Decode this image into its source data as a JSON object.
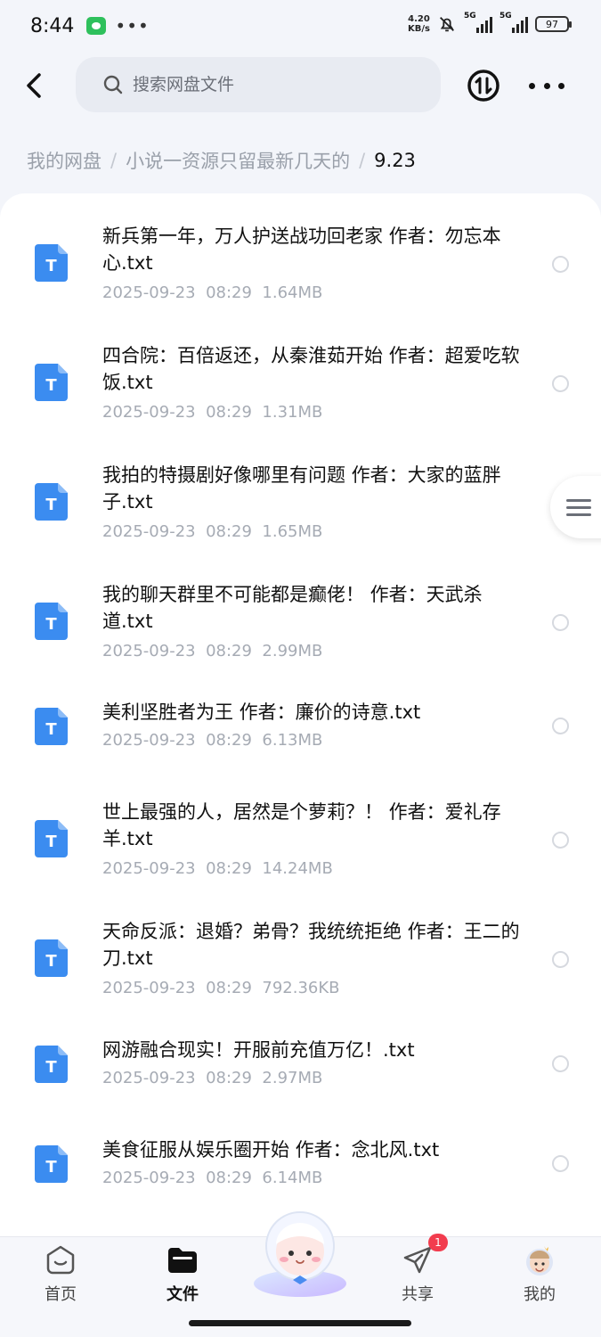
{
  "status_bar": {
    "time": "8:44",
    "net_speed_value": "4.20",
    "net_speed_unit": "KB/s",
    "signal1_label": "5G",
    "signal2_label": "5G",
    "battery": "97"
  },
  "search": {
    "placeholder": "搜索网盘文件"
  },
  "breadcrumb": {
    "items": [
      "我的网盘",
      "小说一资源只留最新几天的"
    ],
    "separator": "/",
    "current": "9.23"
  },
  "files": [
    {
      "name": "新兵第一年，万人护送战功回老家 作者：勿忘本心.txt",
      "date": "2025-09-23",
      "time": "08:29",
      "size": "1.64MB"
    },
    {
      "name": "四合院：百倍返还，从秦淮茹开始 作者：超爱吃软饭.txt",
      "date": "2025-09-23",
      "time": "08:29",
      "size": "1.31MB"
    },
    {
      "name": "我拍的特摄剧好像哪里有问题 作者：大家的蓝胖子.txt",
      "date": "2025-09-23",
      "time": "08:29",
      "size": "1.65MB"
    },
    {
      "name": "我的聊天群里不可能都是癫佬！ 作者：天武杀道.txt",
      "date": "2025-09-23",
      "time": "08:29",
      "size": "2.99MB"
    },
    {
      "name": "美利坚胜者为王 作者：廉价的诗意.txt",
      "date": "2025-09-23",
      "time": "08:29",
      "size": "6.13MB"
    },
    {
      "name": "世上最强的人，居然是个萝莉？！ 作者：爱礼存羊.txt",
      "date": "2025-09-23",
      "time": "08:29",
      "size": "14.24MB"
    },
    {
      "name": "天命反派：退婚？弟骨？我统统拒绝 作者：王二的刀.txt",
      "date": "2025-09-23",
      "time": "08:29",
      "size": "792.36KB"
    },
    {
      "name": "网游融合现实！开服前充值万亿！.txt",
      "date": "2025-09-23",
      "time": "08:29",
      "size": "2.97MB"
    },
    {
      "name": "美食征服从娱乐圈开始 作者：念北风.txt",
      "date": "2025-09-23",
      "time": "08:29",
      "size": "6.14MB"
    }
  ],
  "file_icon_letter": "T",
  "nav": {
    "home": "首页",
    "files": "文件",
    "share": "共享",
    "share_badge": "1",
    "mine": "我的"
  },
  "colors": {
    "accent_blue": "#3b8cf0",
    "badge_red": "#f23c4e"
  }
}
